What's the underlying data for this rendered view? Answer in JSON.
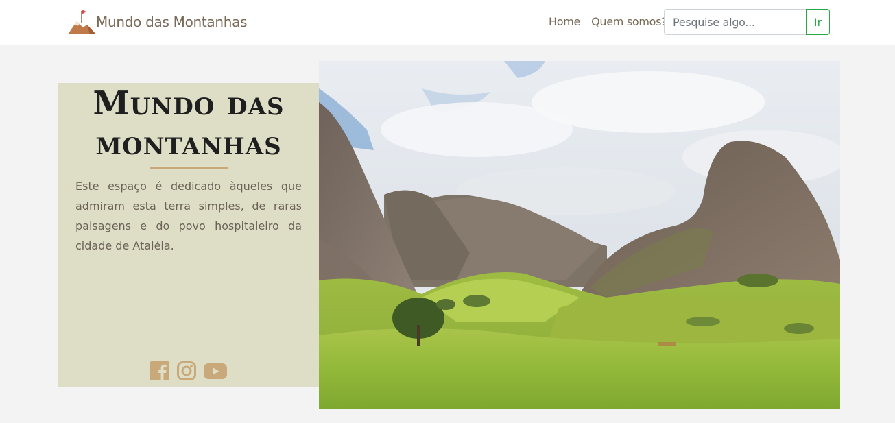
{
  "navbar": {
    "brand": "Mundo das Montanhas",
    "logo_icon": "mountain-flag-icon",
    "links": [
      "Home",
      "Quem somos?"
    ],
    "search": {
      "placeholder": "Pesquise algo...",
      "value": "",
      "button_label": "Ir"
    }
  },
  "hero": {
    "title_line1": "Mundo das",
    "title_line2": "montanhas",
    "description": "Este espaço é dedicado àqueles que admiram esta terra simples, de raras paisagens e do povo hospitaleiro da cidade de Ataléia.",
    "image_icon": "mountain-landscape-photo",
    "socials": [
      {
        "icon": "facebook-icon"
      },
      {
        "icon": "instagram-icon"
      },
      {
        "icon": "youtube-icon"
      }
    ]
  },
  "colors": {
    "panel_bg": "#deddc6",
    "accent": "#c9a97a",
    "nav_text": "#7a6a58",
    "button_green": "#28a745",
    "page_bg": "#f3f3f3"
  }
}
